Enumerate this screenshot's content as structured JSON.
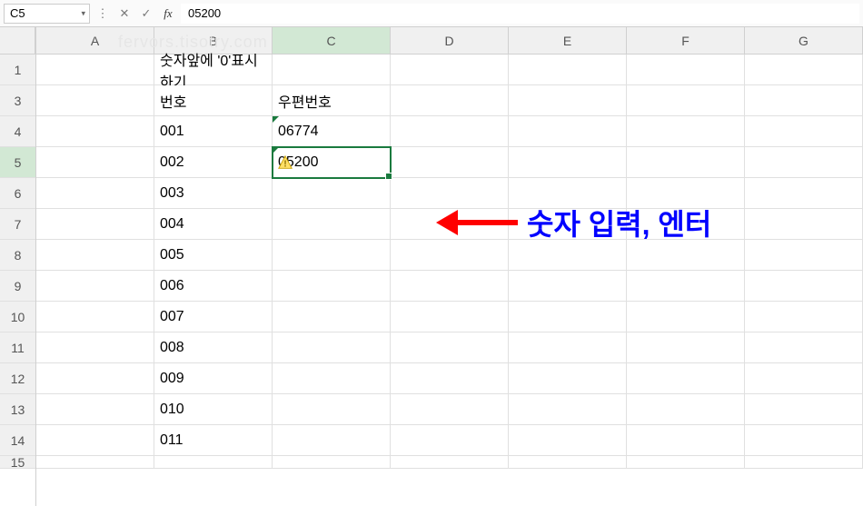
{
  "formula_bar": {
    "cell_ref": "C5",
    "formula_value": "05200"
  },
  "columns": [
    "A",
    "B",
    "C",
    "D",
    "E",
    "F",
    "G"
  ],
  "row_numbers": [
    1,
    3,
    4,
    5,
    6,
    7,
    8,
    9,
    10,
    11,
    12,
    13,
    14,
    15
  ],
  "active_row_index": 3,
  "active_col_index": 2,
  "cells": {
    "B1": "숫자앞에 '0'표시하기",
    "B3": "번호",
    "C3": "우편번호",
    "B4": "001",
    "C4": "06774",
    "B5": "002",
    "C5": "05200",
    "B6": "003",
    "B7": "004",
    "B8": "005",
    "B9": "006",
    "B10": "007",
    "B11": "008",
    "B12": "009",
    "B13": "010",
    "B14": "011"
  },
  "annotation_text": "숫자 입력, 엔터",
  "watermark": "fervors.tisotry.com"
}
